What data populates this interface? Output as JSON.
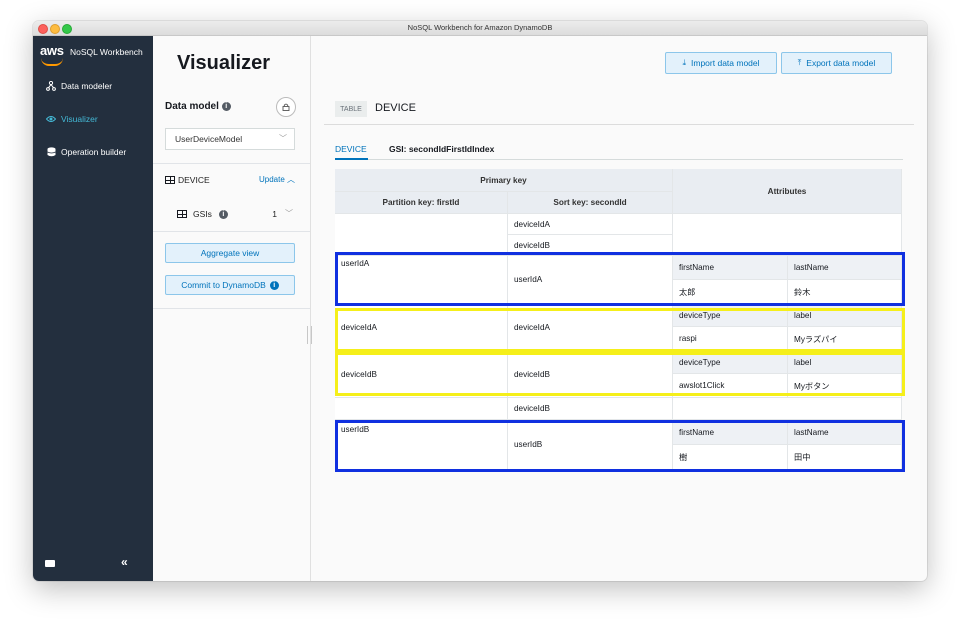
{
  "window": {
    "title": "NoSQL Workbench for Amazon DynamoDB"
  },
  "nav": {
    "logo": "aws",
    "brand": "NoSQL Workbench",
    "items": [
      {
        "label": "Data modeler",
        "icon": "data-modeler-icon"
      },
      {
        "label": "Visualizer",
        "icon": "eye-icon",
        "active": true
      },
      {
        "label": "Operation builder",
        "icon": "database-icon"
      }
    ]
  },
  "header": {
    "title": "Visualizer",
    "import_label": "Import data model",
    "export_label": "Export data model"
  },
  "panel": {
    "data_model_label": "Data model",
    "model_selected": "UserDeviceModel",
    "table_name": "DEVICE",
    "update_label": "Update",
    "gsis_label": "GSIs",
    "gsis_count": "1",
    "aggregate_label": "Aggregate view",
    "commit_label": "Commit to DynamoDB"
  },
  "main": {
    "table_tag": "TABLE",
    "table_name": "DEVICE",
    "tabs": [
      {
        "label": "DEVICE",
        "active": true
      },
      {
        "label": "GSI: secondIdFirstIdIndex",
        "active": false
      }
    ]
  },
  "grid": {
    "primary_key_header": "Primary key",
    "partition_header": "Partition key: firstId",
    "sort_header": "Sort key: secondId",
    "attributes_header": "Attributes",
    "rows": {
      "r1_sort": "deviceIdA",
      "r2_sort": "deviceIdB",
      "ua_pk": "userIdA",
      "ua_sort": "userIdA",
      "ua_attr1_name": "firstName",
      "ua_attr2_name": "lastName",
      "ua_attr1_val": "太郎",
      "ua_attr2_val": "鈴木",
      "da_pk": "deviceIdA",
      "da_sort": "deviceIdA",
      "da_attr1_name": "deviceType",
      "da_attr2_name": "label",
      "da_attr1_val": "raspi",
      "da_attr2_val": "Myラズパイ",
      "db_pk": "deviceIdB",
      "db_sort": "deviceIdB",
      "db_attr1_name": "deviceType",
      "db_attr2_name": "label",
      "db_attr1_val": "awslot1Click",
      "db_attr2_val": "Myボタン",
      "r8_sort": "deviceIdB",
      "ub_pk": "userIdB",
      "ub_sort": "userIdB",
      "ub_attr1_name": "firstName",
      "ub_attr2_name": "lastName",
      "ub_attr1_val": "樹",
      "ub_attr2_val": "田中"
    }
  },
  "colors": {
    "nav_bg": "#232f3e",
    "accent": "#0073bb",
    "highlight_user": "#1030e0",
    "highlight_device": "#f5ef1a"
  }
}
